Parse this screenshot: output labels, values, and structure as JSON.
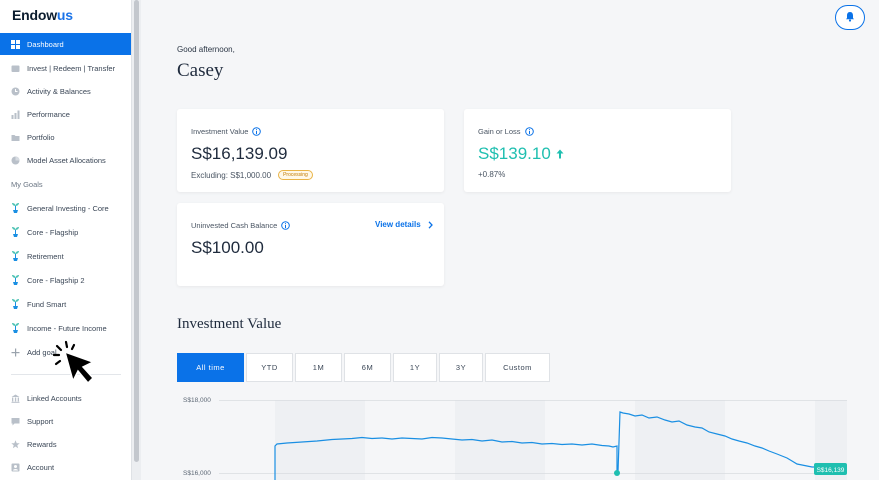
{
  "brand": {
    "name_part1": "Endow",
    "name_part2": "us"
  },
  "sidebar": {
    "items": [
      {
        "label": "Dashboard",
        "icon": "dashboard-icon",
        "active": true
      },
      {
        "label": "Invest | Redeem | Transfer",
        "icon": "wallet-icon"
      },
      {
        "label": "Activity & Balances",
        "icon": "clock-icon"
      },
      {
        "label": "Performance",
        "icon": "bar-chart-icon"
      },
      {
        "label": "Portfolio",
        "icon": "folder-icon"
      },
      {
        "label": "Model Asset Allocations",
        "icon": "pie-icon"
      }
    ],
    "goals_label": "My Goals",
    "goals": [
      {
        "label": "General Investing - Core",
        "icon": "plant-icon"
      },
      {
        "label": "Core - Flagship",
        "icon": "plant-icon"
      },
      {
        "label": "Retirement",
        "icon": "plant-icon"
      },
      {
        "label": "Core - Flagship 2",
        "icon": "plant-icon"
      },
      {
        "label": "Fund Smart",
        "icon": "plant-icon"
      },
      {
        "label": "Income - Future Income",
        "icon": "plant-icon"
      }
    ],
    "add_goal": "Add goal",
    "footer": [
      {
        "label": "Linked Accounts",
        "icon": "bank-icon"
      },
      {
        "label": "Support",
        "icon": "chat-icon"
      },
      {
        "label": "Rewards",
        "icon": "star-icon"
      },
      {
        "label": "Account",
        "icon": "user-icon"
      }
    ]
  },
  "header": {
    "greeting": "Good afternoon,",
    "username": "Casey"
  },
  "cards": {
    "investment": {
      "label": "Investment Value",
      "value": "S$16,139.09",
      "excluding": "Excluding: S$1,000.00",
      "badge": "Processing"
    },
    "gain": {
      "label": "Gain or Loss",
      "value": "S$139.10",
      "percent": "+0.87%"
    },
    "cash": {
      "label": "Uninvested Cash Balance",
      "value": "S$100.00",
      "link": "View details"
    }
  },
  "section_title": "Investment Value",
  "range_tabs": [
    "All time",
    "YTD",
    "1M",
    "6M",
    "1Y",
    "3Y",
    "Custom"
  ],
  "active_range": "All time",
  "chart": {
    "y_ticks": [
      "S$18,000",
      "S$16,000"
    ],
    "end_label": "S$16,139"
  },
  "colors": {
    "accent": "#0a72e8",
    "gain": "#1fbfb0",
    "line": "#1a8fe3"
  }
}
